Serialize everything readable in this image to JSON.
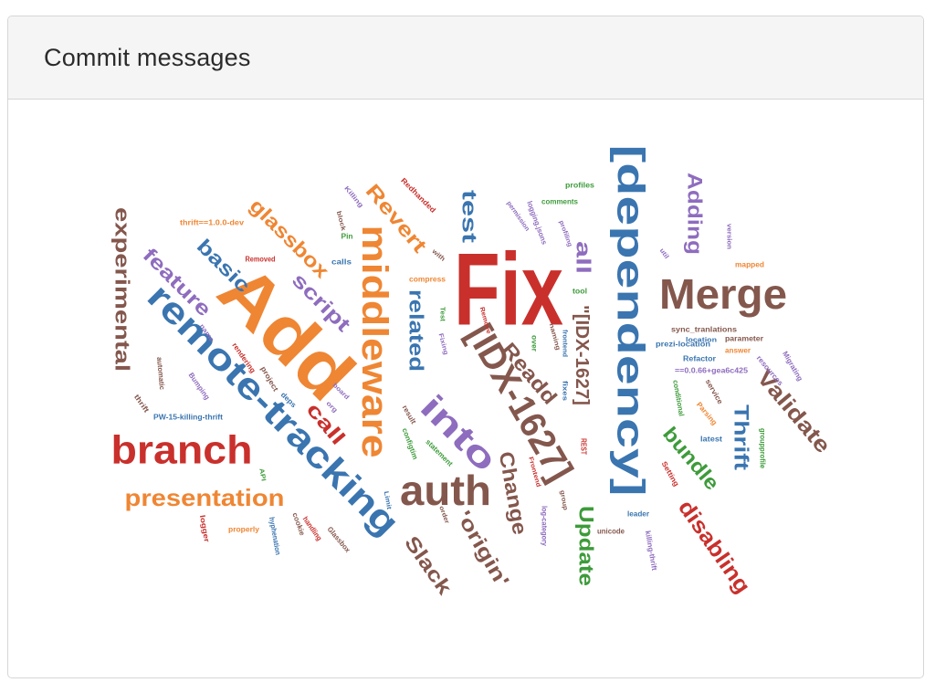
{
  "panel": {
    "title": "Commit messages"
  },
  "palette": {
    "blue": "#3a75b0",
    "orange": "#ef8633",
    "red": "#c9302c",
    "brown": "#84574d",
    "purple": "#8e6cbe",
    "green": "#3d9b3a",
    "gray": "#7a7a7a"
  },
  "word_cloud": {
    "words": [
      {
        "text": "Fix",
        "color": "red"
      },
      {
        "text": "[dependency]",
        "color": "blue"
      },
      {
        "text": "Add",
        "color": "orange"
      },
      {
        "text": "remote-tracking",
        "color": "blue"
      },
      {
        "text": "branch",
        "color": "red"
      },
      {
        "text": "Merge",
        "color": "brown"
      },
      {
        "text": "middleware",
        "color": "orange"
      },
      {
        "text": "[IDX-1627]",
        "color": "brown"
      },
      {
        "text": "auth",
        "color": "brown"
      },
      {
        "text": "into",
        "color": "purple"
      },
      {
        "text": "presentation",
        "color": "orange"
      },
      {
        "text": "experimental",
        "color": "brown"
      },
      {
        "text": "Validate",
        "color": "brown"
      },
      {
        "text": "disabling",
        "color": "red"
      },
      {
        "text": "glassbox",
        "color": "orange"
      },
      {
        "text": "Revert",
        "color": "orange"
      },
      {
        "text": "feature",
        "color": "purple"
      },
      {
        "text": "basic",
        "color": "blue"
      },
      {
        "text": "script",
        "color": "purple"
      },
      {
        "text": "related",
        "color": "blue"
      },
      {
        "text": "test",
        "color": "blue"
      },
      {
        "text": "Readd",
        "color": "brown"
      },
      {
        "text": "\"[IDX-1627]",
        "color": "brown"
      },
      {
        "text": "all",
        "color": "purple"
      },
      {
        "text": "Adding",
        "color": "purple"
      },
      {
        "text": "Thrift",
        "color": "blue"
      },
      {
        "text": "bundle",
        "color": "green"
      },
      {
        "text": "Change",
        "color": "brown"
      },
      {
        "text": "'origin'",
        "color": "brown"
      },
      {
        "text": "Slack",
        "color": "brown"
      },
      {
        "text": "Update",
        "color": "green"
      },
      {
        "text": "call",
        "color": "red"
      },
      {
        "text": "thrift==1.0.0-dev",
        "color": "orange"
      },
      {
        "text": "Removed",
        "color": "red"
      },
      {
        "text": "Pin",
        "color": "green"
      },
      {
        "text": "block",
        "color": "brown"
      },
      {
        "text": "calls",
        "color": "blue"
      },
      {
        "text": "with",
        "color": "brown"
      },
      {
        "text": "compress",
        "color": "orange"
      },
      {
        "text": "Killing",
        "color": "purple"
      },
      {
        "text": "Redhanded",
        "color": "red"
      },
      {
        "text": "logging.jsons",
        "color": "purple"
      },
      {
        "text": "permission",
        "color": "purple"
      },
      {
        "text": "comments",
        "color": "green"
      },
      {
        "text": "profiles",
        "color": "green"
      },
      {
        "text": "profiling",
        "color": "purple"
      },
      {
        "text": "tool",
        "color": "green"
      },
      {
        "text": "util",
        "color": "purple"
      },
      {
        "text": "version",
        "color": "purple"
      },
      {
        "text": "mapped",
        "color": "orange"
      },
      {
        "text": "prezi-location",
        "color": "blue"
      },
      {
        "text": "sync_tranlations",
        "color": "brown"
      },
      {
        "text": "parameter",
        "color": "brown"
      },
      {
        "text": "location",
        "color": "blue"
      },
      {
        "text": "answer",
        "color": "orange"
      },
      {
        "text": "Refactor",
        "color": "blue"
      },
      {
        "text": "==0.0.66+gea6c425",
        "color": "purple"
      },
      {
        "text": "resources",
        "color": "purple"
      },
      {
        "text": "Migrating",
        "color": "purple"
      },
      {
        "text": "service",
        "color": "brown"
      },
      {
        "text": "conditional",
        "color": "green"
      },
      {
        "text": "Parsing",
        "color": "orange"
      },
      {
        "text": "latest",
        "color": "blue"
      },
      {
        "text": "groupprofile",
        "color": "green"
      },
      {
        "text": "Setting",
        "color": "red"
      },
      {
        "text": "name",
        "color": "purple"
      },
      {
        "text": "rendering",
        "color": "red"
      },
      {
        "text": "automatic",
        "color": "brown"
      },
      {
        "text": "thrift",
        "color": "brown"
      },
      {
        "text": "Bumping",
        "color": "purple"
      },
      {
        "text": "project",
        "color": "brown"
      },
      {
        "text": "deps",
        "color": "blue"
      },
      {
        "text": "board",
        "color": "purple"
      },
      {
        "text": "org",
        "color": "purple"
      },
      {
        "text": "PW-15-killing-thrift",
        "color": "blue"
      },
      {
        "text": "Test",
        "color": "green"
      },
      {
        "text": "Fixing",
        "color": "purple"
      },
      {
        "text": "Remove",
        "color": "red"
      },
      {
        "text": "over",
        "color": "green"
      },
      {
        "text": "naming",
        "color": "brown"
      },
      {
        "text": "frontend",
        "color": "blue"
      },
      {
        "text": "fixes",
        "color": "blue"
      },
      {
        "text": "result",
        "color": "brown"
      },
      {
        "text": "configtim",
        "color": "green"
      },
      {
        "text": "statement",
        "color": "green"
      },
      {
        "text": "REST",
        "color": "red"
      },
      {
        "text": "Frontend",
        "color": "red"
      },
      {
        "text": "API",
        "color": "green"
      },
      {
        "text": "Limit",
        "color": "blue"
      },
      {
        "text": "order",
        "color": "brown"
      },
      {
        "text": "logger",
        "color": "red"
      },
      {
        "text": "properly",
        "color": "orange"
      },
      {
        "text": "hyphenation",
        "color": "blue"
      },
      {
        "text": "cookie",
        "color": "brown"
      },
      {
        "text": "handling",
        "color": "red"
      },
      {
        "text": "Glassbox",
        "color": "brown"
      },
      {
        "text": "group",
        "color": "brown"
      },
      {
        "text": "log-category",
        "color": "purple"
      },
      {
        "text": "unicode",
        "color": "brown"
      },
      {
        "text": "leader",
        "color": "blue"
      },
      {
        "text": "killing-thrift",
        "color": "purple"
      }
    ]
  }
}
